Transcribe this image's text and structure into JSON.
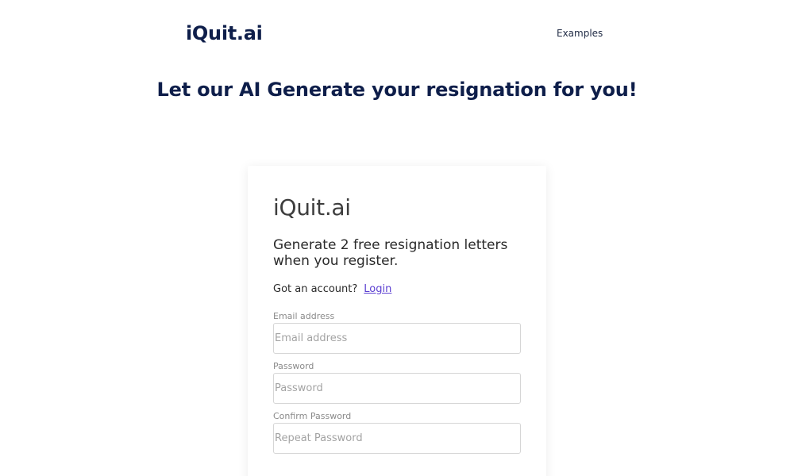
{
  "header": {
    "brand": "iQuit.ai",
    "nav": [
      {
        "label": "Examples"
      }
    ]
  },
  "hero": {
    "title": "Let our AI Generate your resignation for you!"
  },
  "signup_card": {
    "title": "iQuit.ai",
    "subtitle": "Generate 2 free resignation letters when you register.",
    "account_prompt": "Got an account?",
    "login_label": "Login",
    "fields": [
      {
        "label": "Email address",
        "placeholder": "Email address",
        "value": ""
      },
      {
        "label": "Password",
        "placeholder": "Password",
        "value": ""
      },
      {
        "label": "Confirm Password",
        "placeholder": "Repeat Password",
        "value": ""
      }
    ]
  },
  "colors": {
    "brand_navy": "#0e1e4a",
    "link_purple": "#5b3fd1",
    "input_border": "#d6d6d6"
  }
}
